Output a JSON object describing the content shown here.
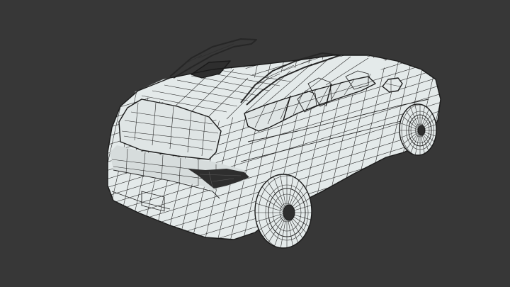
{
  "viewport": {
    "background": "#373737",
    "mesh_fill": "#e4eaea",
    "wire_color": "#262626",
    "subject": "car-wireframe-mesh"
  }
}
